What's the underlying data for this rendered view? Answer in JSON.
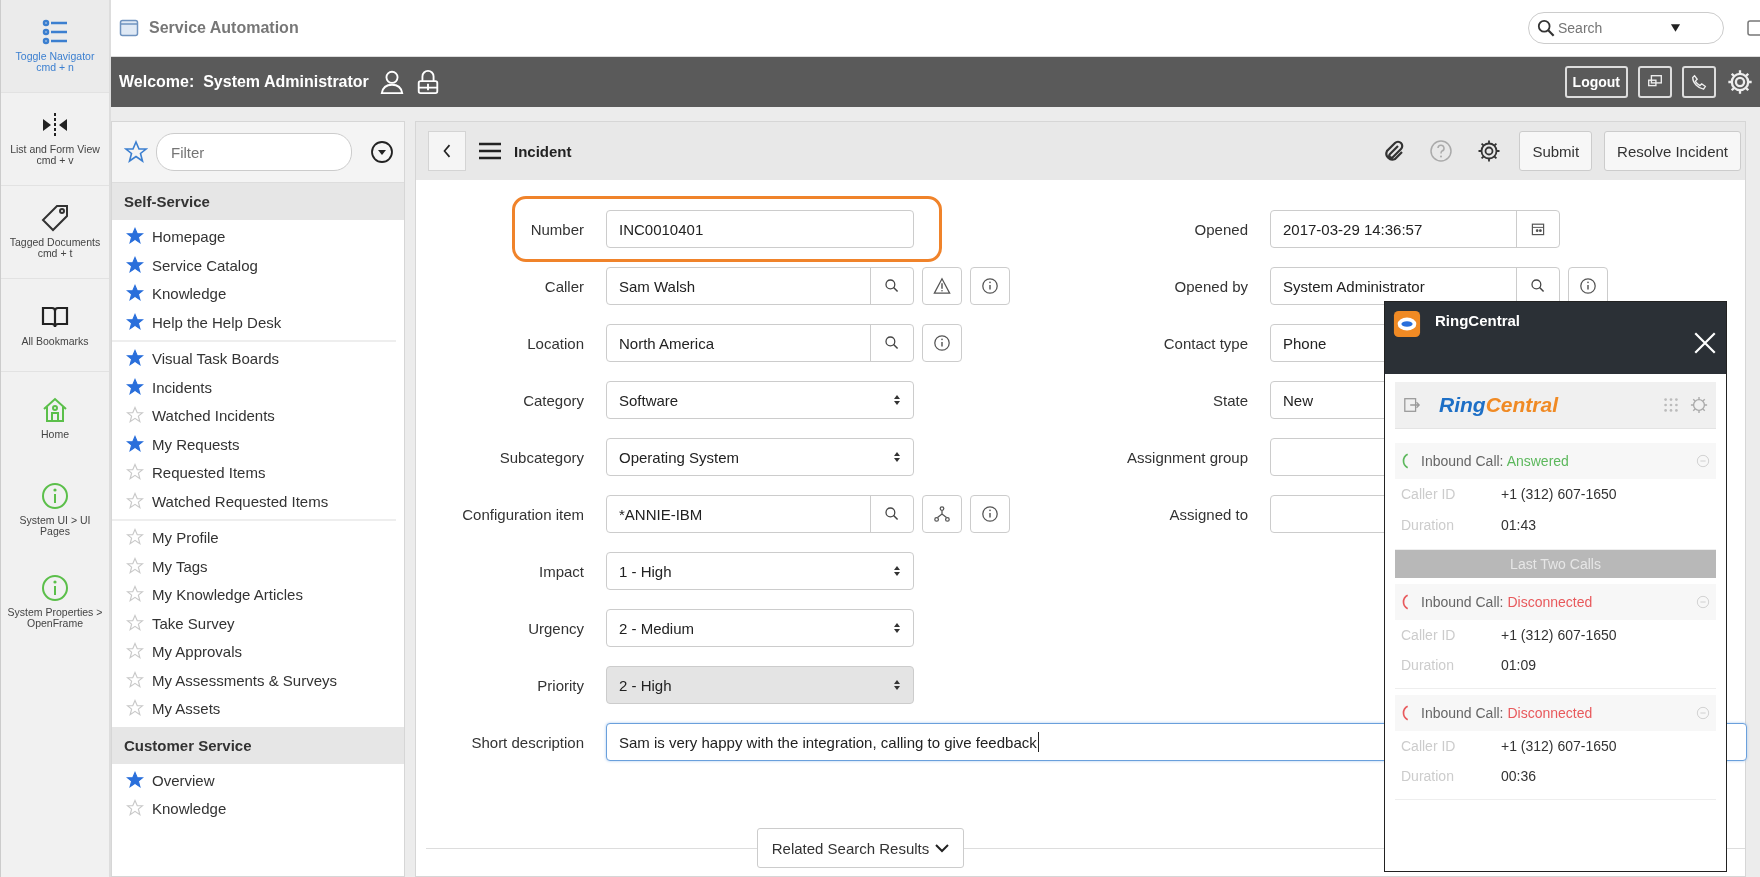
{
  "rail": [
    {
      "kind": "navigator",
      "label": "Toggle Navigator",
      "shortcut": "cmd + n",
      "selected": true
    },
    {
      "kind": "split",
      "label": "List and Form View",
      "shortcut": "cmd + v",
      "selected": false
    },
    {
      "kind": "tag",
      "label": "Tagged Documents",
      "shortcut": "cmd + t",
      "selected": false
    },
    {
      "kind": "book",
      "label": "All Bookmarks",
      "selected": false
    },
    {
      "kind": "home",
      "label": "Home",
      "selected": false
    },
    {
      "kind": "info",
      "label": "System UI > UI Pages",
      "selected": false
    },
    {
      "kind": "info",
      "label": "System Properties > OpenFrame",
      "selected": false
    }
  ],
  "window": {
    "title": "Service Automation",
    "search": {
      "placeholder": "Search"
    }
  },
  "banner": {
    "welcome": "Welcome:  System Administrator",
    "logout": "Logout"
  },
  "sidebar": {
    "filter": {
      "placeholder": "Filter"
    },
    "sections": [
      {
        "title": "Self-Service",
        "groups": [
          [
            {
              "label": "Homepage",
              "favorite": true
            },
            {
              "label": "Service Catalog",
              "favorite": true
            },
            {
              "label": "Knowledge",
              "favorite": true
            },
            {
              "label": "Help the Help Desk",
              "favorite": true
            }
          ],
          [
            {
              "label": "Visual Task Boards",
              "favorite": true
            },
            {
              "label": "Incidents",
              "favorite": true
            },
            {
              "label": "Watched Incidents",
              "favorite": false
            },
            {
              "label": "My Requests",
              "favorite": true
            },
            {
              "label": "Requested Items",
              "favorite": false
            },
            {
              "label": "Watched Requested Items",
              "favorite": false
            }
          ],
          [
            {
              "label": "My Profile",
              "favorite": false
            },
            {
              "label": "My Tags",
              "favorite": false
            },
            {
              "label": "My Knowledge Articles",
              "favorite": false
            },
            {
              "label": "Take Survey",
              "favorite": false
            },
            {
              "label": "My Approvals",
              "favorite": false
            },
            {
              "label": "My Assessments & Surveys",
              "favorite": false
            },
            {
              "label": "My Assets",
              "favorite": false
            }
          ]
        ]
      },
      {
        "title": "Customer Service",
        "groups": [
          [
            {
              "label": "Overview",
              "favorite": true
            },
            {
              "label": "Knowledge",
              "favorite": false
            }
          ]
        ]
      }
    ]
  },
  "form": {
    "title": "Incident",
    "buttons": [
      "Submit",
      "Resolve Incident"
    ],
    "left_fields": [
      {
        "label": "Number",
        "kind": "text",
        "value": "INC0010401",
        "highlighted": true
      },
      {
        "label": "Caller",
        "kind": "reference",
        "value": "Sam Walsh",
        "actions": [
          {
            "kind": "alert"
          },
          {
            "kind": "info"
          }
        ]
      },
      {
        "label": "Location",
        "kind": "reference",
        "value": "North America",
        "actions": [
          {
            "kind": "info"
          }
        ]
      },
      {
        "label": "Category",
        "kind": "select",
        "value": "Software"
      },
      {
        "label": "Subcategory",
        "kind": "select",
        "value": "Operating System"
      },
      {
        "label": "Configuration item",
        "kind": "reference",
        "value": "*ANNIE-IBM",
        "actions": [
          {
            "kind": "hierarchy"
          },
          {
            "kind": "info"
          }
        ]
      },
      {
        "label": "Impact",
        "kind": "select",
        "value": "1 - High"
      },
      {
        "label": "Urgency",
        "kind": "select",
        "value": "2 - Medium"
      },
      {
        "label": "Priority",
        "kind": "select",
        "value": "2 - High",
        "disabled": true
      }
    ],
    "right_fields": [
      {
        "label": "Opened",
        "kind": "date",
        "value": "2017-03-29 14:36:57"
      },
      {
        "label": "Opened by",
        "kind": "reference",
        "value": "System Administrator",
        "actions": [
          {
            "kind": "info"
          }
        ]
      },
      {
        "label": "Contact type",
        "kind": "text",
        "value": "Phone"
      },
      {
        "label": "State",
        "kind": "text",
        "value": "New"
      },
      {
        "label": "Assignment group",
        "kind": "text"
      },
      {
        "label": "Assigned to",
        "kind": "text"
      }
    ],
    "short_description": {
      "label": "Short description",
      "value": "Sam is very happy with the integration, calling to give feedback",
      "focused": true
    },
    "related": "Related Search Results"
  },
  "popup": {
    "title": "RingCentral",
    "logo": [
      "Ring",
      "Central"
    ],
    "history_label": "Last Two Calls",
    "calls": [
      {
        "direction": "Inbound Call:",
        "status": "Answered",
        "color": "#5cb85c",
        "caller_id_label": "Caller ID",
        "caller_id": "+1 (312) 607-1650",
        "duration_label": "Duration",
        "duration": "01:43"
      },
      {
        "direction": "Inbound Call:",
        "status": "Disconnected",
        "color": "#e8595c",
        "caller_id_label": "Caller ID",
        "caller_id": "+1 (312) 607-1650",
        "duration_label": "Duration",
        "duration": "01:09"
      },
      {
        "direction": "Inbound Call:",
        "status": "Disconnected",
        "color": "#e8595c",
        "caller_id_label": "Caller ID",
        "caller_id": "+1 (312) 607-1650",
        "duration_label": "Duration",
        "duration": "00:36"
      }
    ]
  }
}
